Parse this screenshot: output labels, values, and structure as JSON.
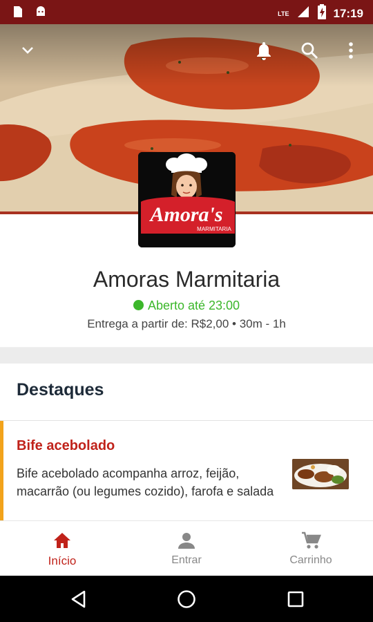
{
  "status_bar": {
    "time": "17:19",
    "network": "LTE",
    "icons": [
      "sd-card-icon",
      "android-icon",
      "signal-icon",
      "battery-icon"
    ]
  },
  "header": {
    "icons": [
      "chevron-down-icon",
      "bell-icon",
      "search-icon",
      "more-vert-icon"
    ]
  },
  "logo": {
    "brand": "Amora's",
    "sub": "MARMITARIA"
  },
  "store": {
    "name": "Amoras Marmitaria",
    "status": "Aberto até 23:00",
    "delivery": "Entrega a partir de: R$2,00 • 30m - 1h"
  },
  "highlights": {
    "title": "Destaques",
    "items": [
      {
        "name": "Bife acebolado",
        "description": "Bife acebolado acompanha arroz, feijão, macarrão (ou legumes cozido), farofa e salada"
      }
    ]
  },
  "bottom_nav": {
    "items": [
      {
        "label": "Início",
        "icon": "home-icon",
        "active": true
      },
      {
        "label": "Entrar",
        "icon": "person-icon",
        "active": false
      },
      {
        "label": "Carrinho",
        "icon": "cart-icon",
        "active": false
      }
    ]
  },
  "system_nav": {
    "icons": [
      "back-icon",
      "home-circle-icon",
      "recents-icon"
    ]
  },
  "colors": {
    "brand_dark_red": "#7a1515",
    "accent_red": "#c0221a",
    "open_green": "#3cb72b",
    "highlight_orange": "#f2a31b"
  }
}
